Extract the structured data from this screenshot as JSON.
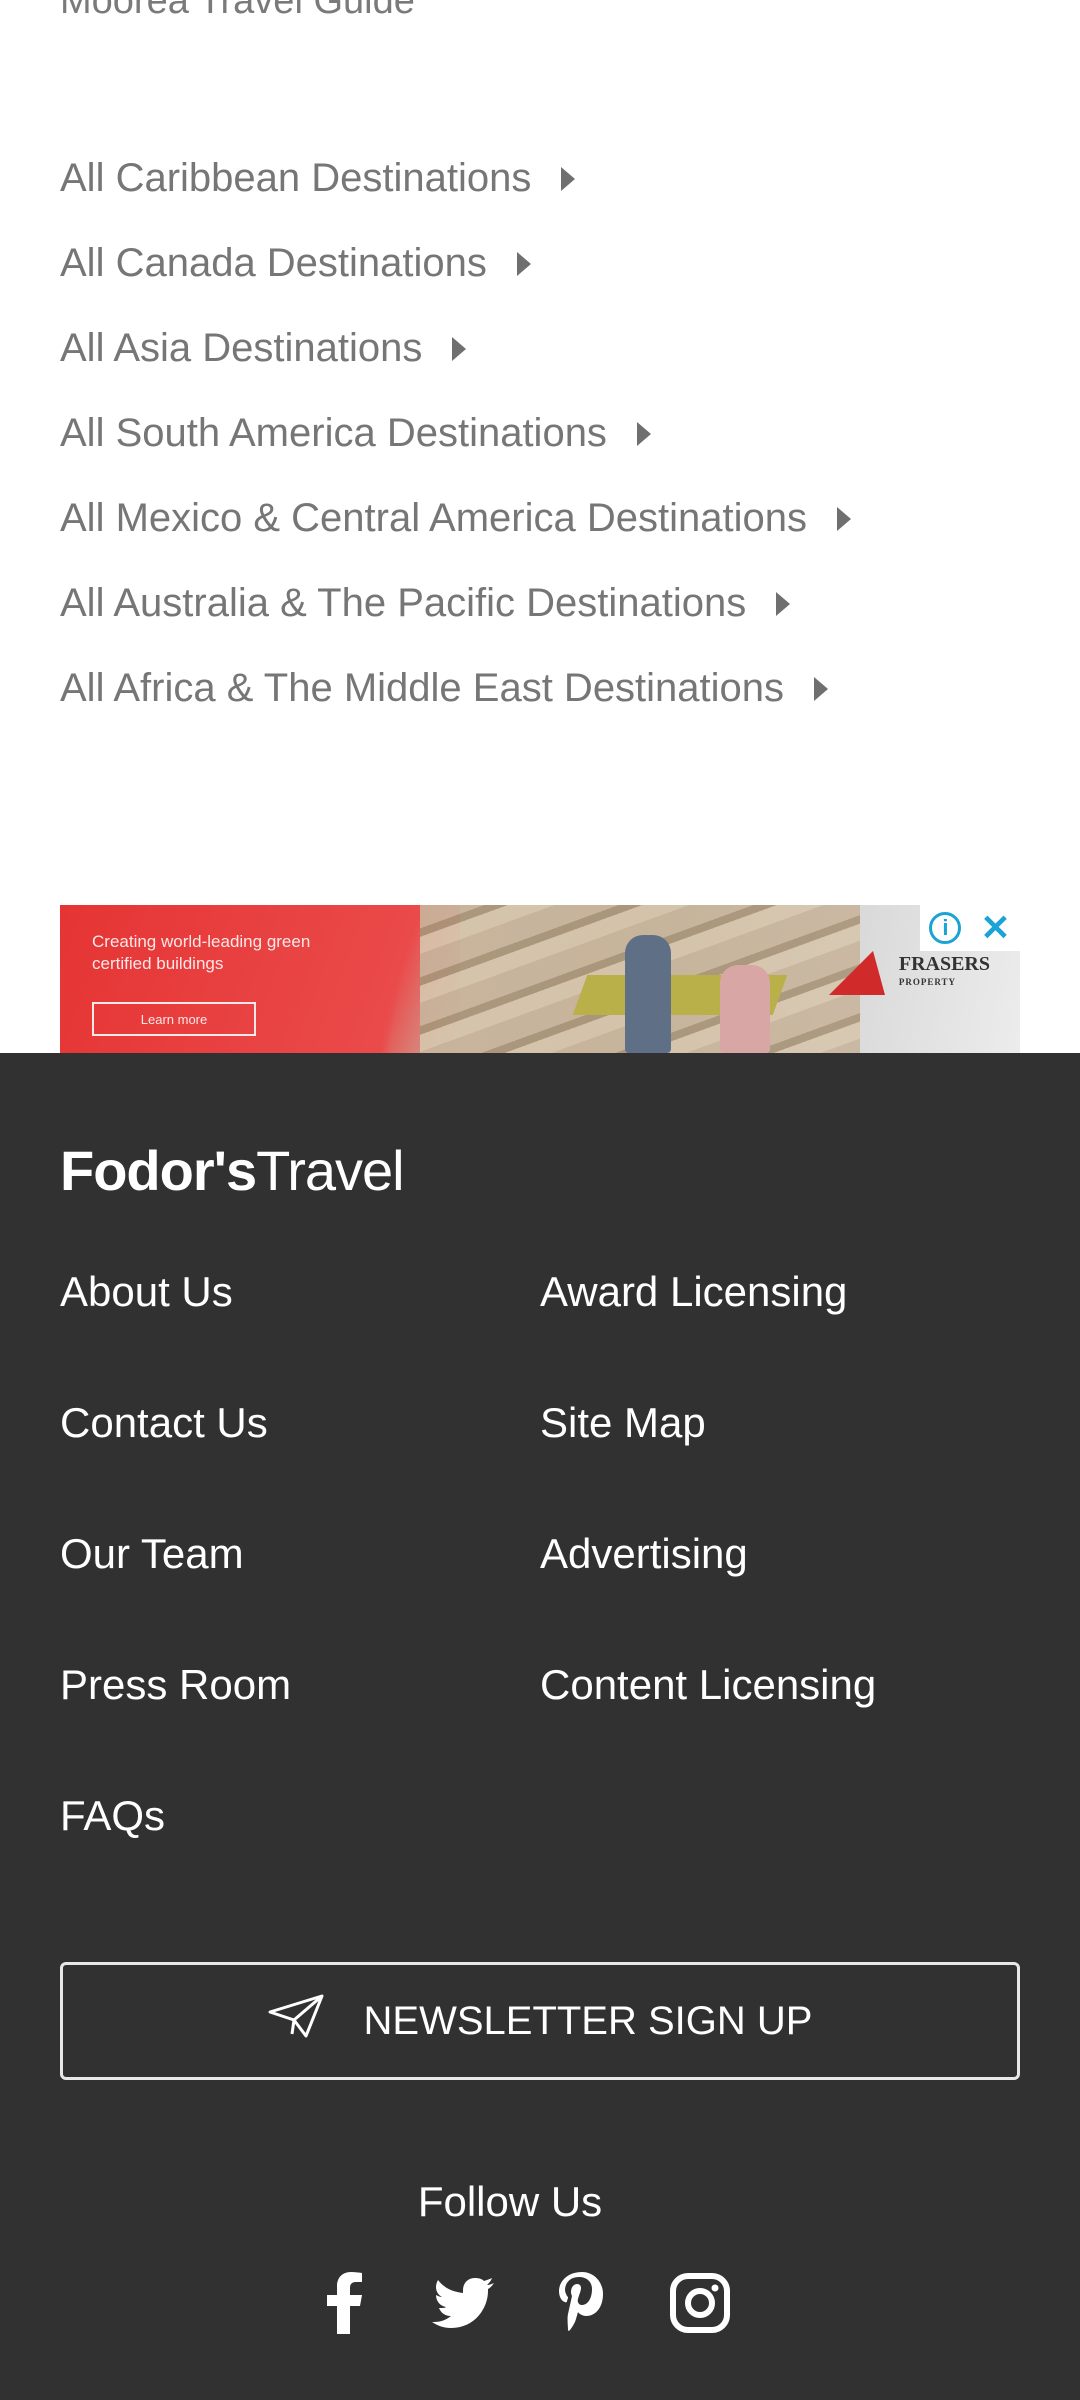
{
  "top": {
    "guide_link": "Moorea Travel Guide",
    "destinations": [
      "All Caribbean Destinations",
      "All Canada Destinations",
      "All Asia Destinations",
      "All South America Destinations",
      "All Mexico & Central America Destinations",
      "All Australia & The Pacific Destinations",
      "All Africa & The Middle East Destinations"
    ]
  },
  "ad": {
    "headline": "Creating world-leading green certified buildings",
    "button": "Learn more",
    "brand": "FRASERS",
    "brand_sub": "PROPERTY",
    "info_glyph": "i",
    "close_glyph": "✕"
  },
  "footer": {
    "brand_bold": "Fodor's",
    "brand_light": "Travel",
    "links_left": [
      "About Us",
      "Contact Us",
      "Our Team",
      "Press Room",
      "FAQs"
    ],
    "links_right": [
      "Award Licensing",
      "Site Map",
      "Advertising",
      "Content Licensing"
    ],
    "newsletter_label": "NEWSLETTER SIGN UP",
    "follow_label": "Follow Us",
    "social_icons": [
      "facebook-icon",
      "twitter-icon",
      "pinterest-icon",
      "instagram-icon"
    ]
  },
  "colors": {
    "footer_bg": "#313131",
    "link_gray": "#767676",
    "ad_red": "#e23b3b",
    "ad_blue": "#1aa3d4"
  }
}
